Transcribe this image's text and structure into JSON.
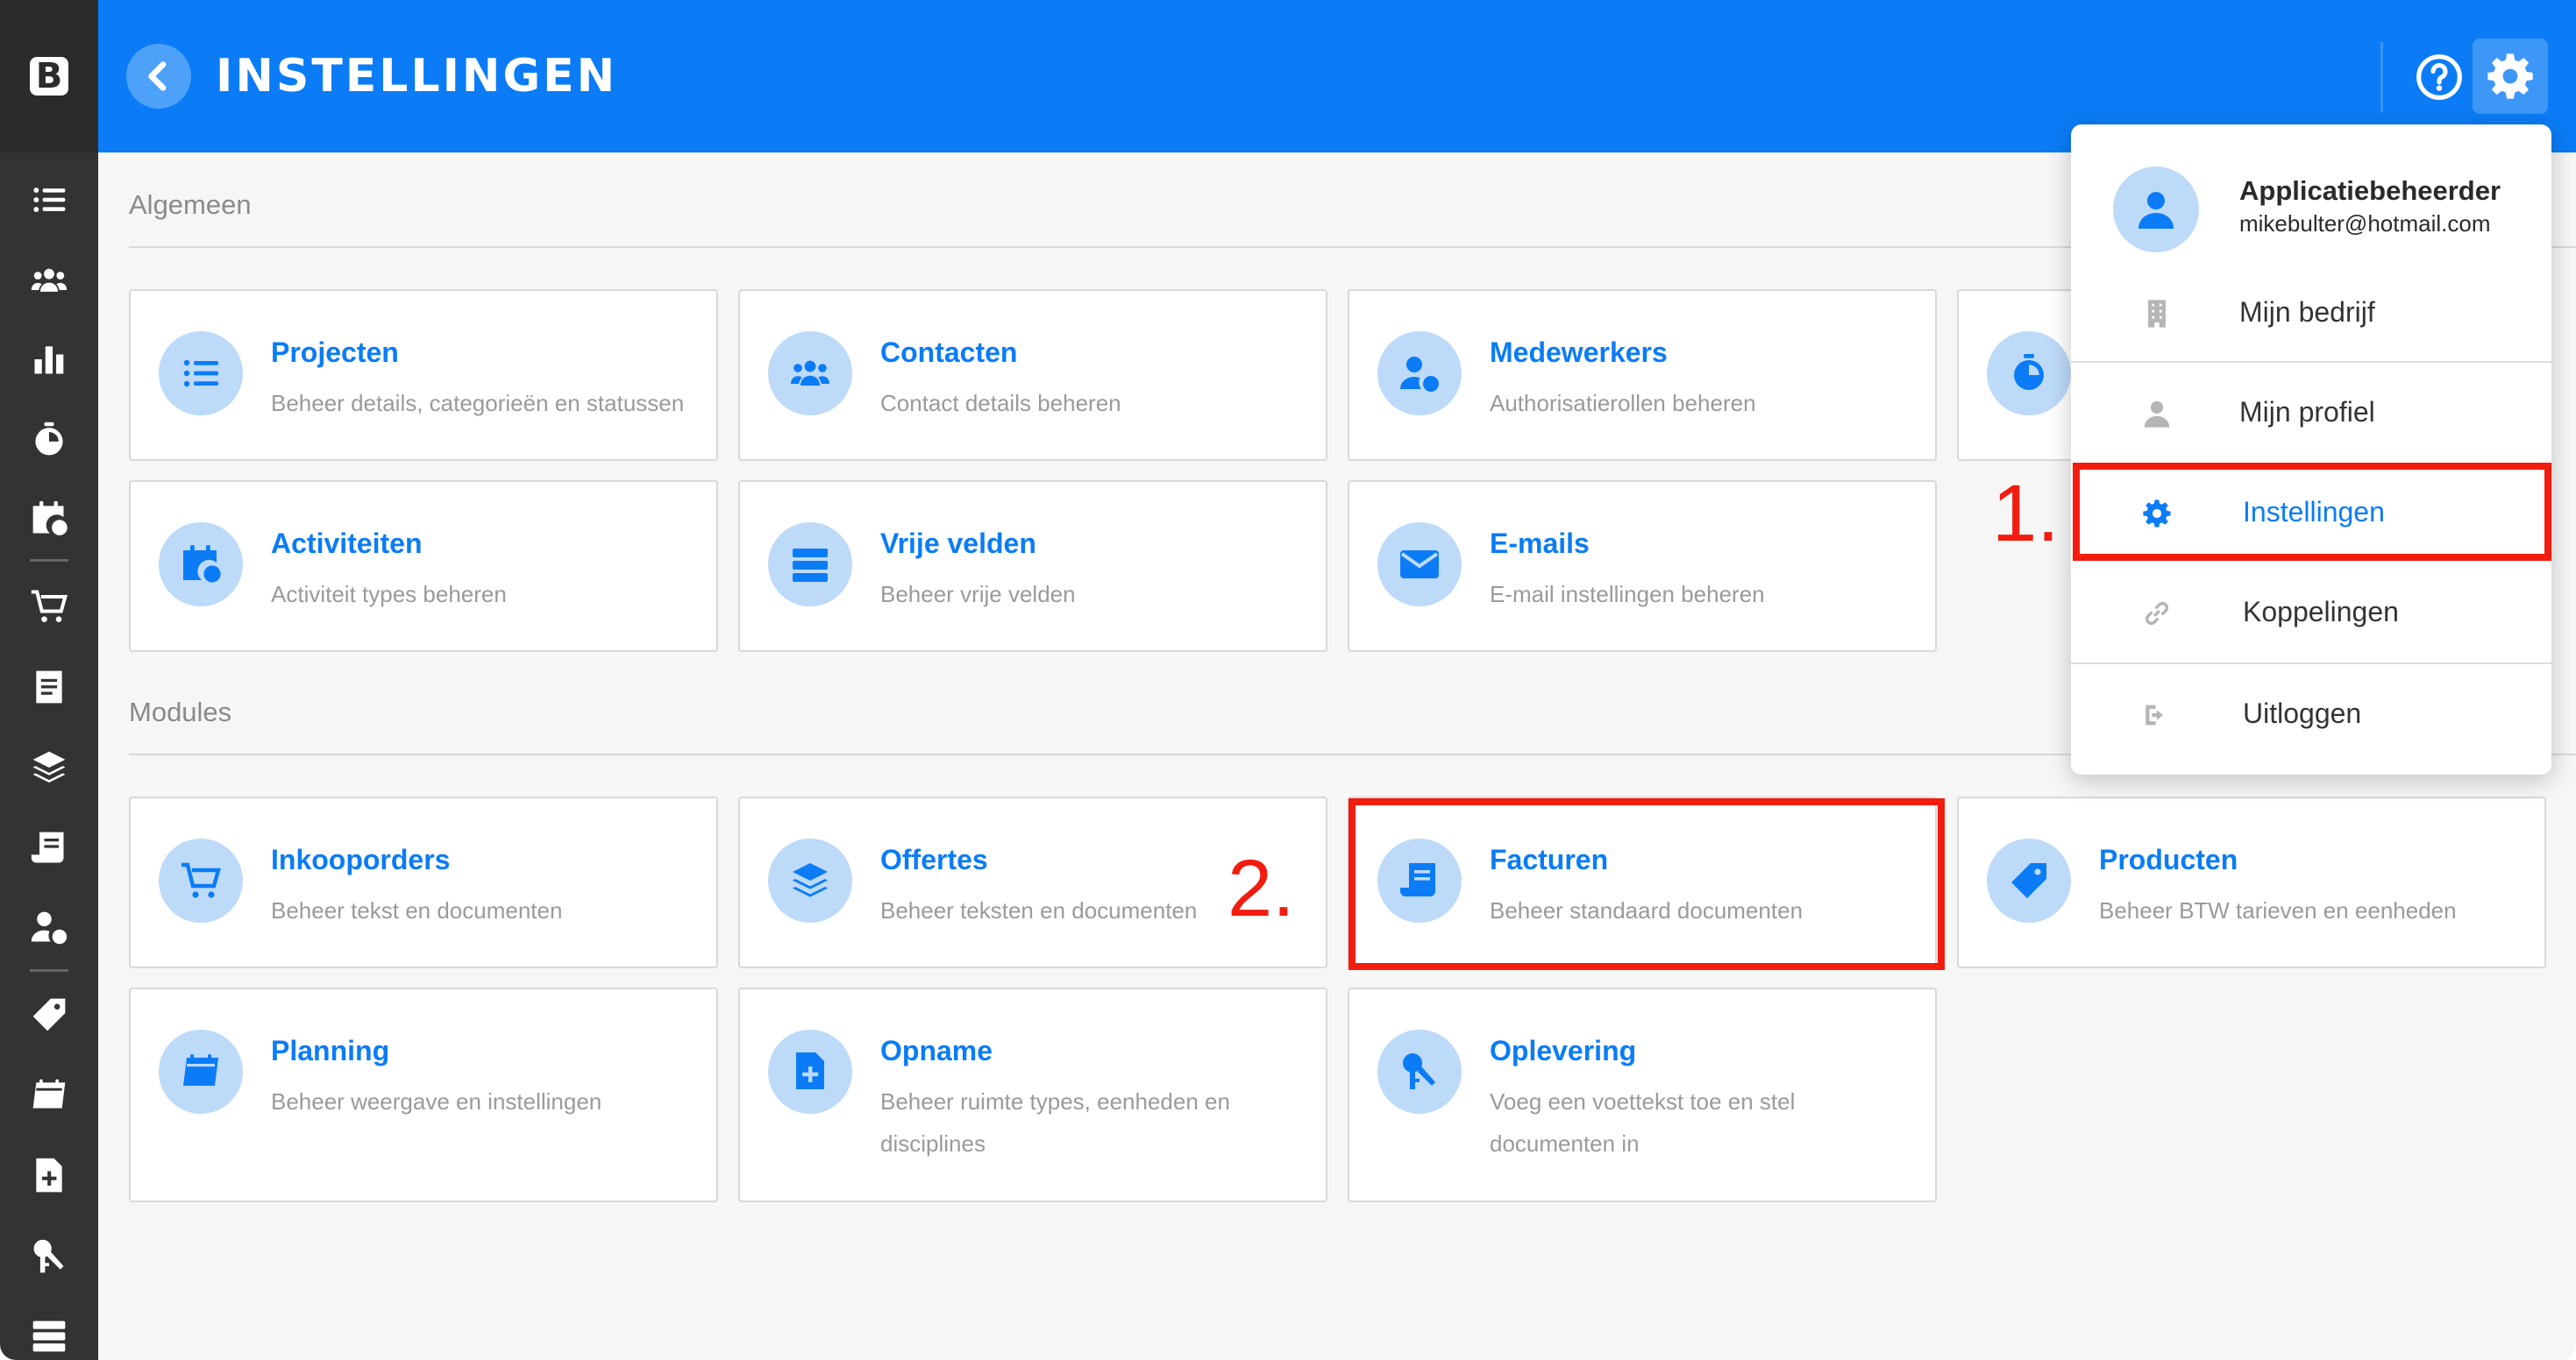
{
  "sidebar": {
    "logo": "B"
  },
  "header": {
    "title": "INSTELLINGEN"
  },
  "sections": {
    "general": "Algemeen",
    "modules": "Modules"
  },
  "cards": {
    "projecten": {
      "title": "Projecten",
      "desc": "Beheer details, categorieën en statussen"
    },
    "contacten": {
      "title": "Contacten",
      "desc": "Contact details beheren"
    },
    "medewerkers": {
      "title": "Medewerkers",
      "desc": "Authorisatierollen beheren"
    },
    "activiteiten": {
      "title": "Activiteiten",
      "desc": "Activiteit types beheren"
    },
    "vrije_velden": {
      "title": "Vrije velden",
      "desc": "Beheer vrije velden"
    },
    "emails": {
      "title": "E-mails",
      "desc": "E-mail instellingen beheren"
    },
    "inkooporders": {
      "title": "Inkooporders",
      "desc": "Beheer tekst en documenten"
    },
    "offertes": {
      "title": "Offertes",
      "desc": "Beheer teksten en documenten"
    },
    "facturen": {
      "title": "Facturen",
      "desc": "Beheer standaard documenten"
    },
    "producten": {
      "title": "Producten",
      "desc": "Beheer BTW tarieven en eenheden"
    },
    "planning": {
      "title": "Planning",
      "desc": "Beheer weergave en instellingen"
    },
    "opname": {
      "title": "Opname",
      "desc": "Beheer ruimte types, eenheden en disciplines"
    },
    "oplevering": {
      "title": "Oplevering",
      "desc": "Voeg een voettekst toe en stel documenten in"
    }
  },
  "dropdown": {
    "user_name": "Applicatiebeheerder",
    "user_email": "mikebulter@hotmail.com",
    "items": {
      "bedrijf": "Mijn bedrijf",
      "profiel": "Mijn profiel",
      "instellingen": "Instellingen",
      "koppelingen": "Koppelingen",
      "uitloggen": "Uitloggen"
    }
  },
  "annotations": {
    "step1": "1.",
    "step2": "2."
  },
  "colors": {
    "brand": "#0b7cf5",
    "sidebar": "#333333",
    "annotation": "#f21c0f"
  }
}
